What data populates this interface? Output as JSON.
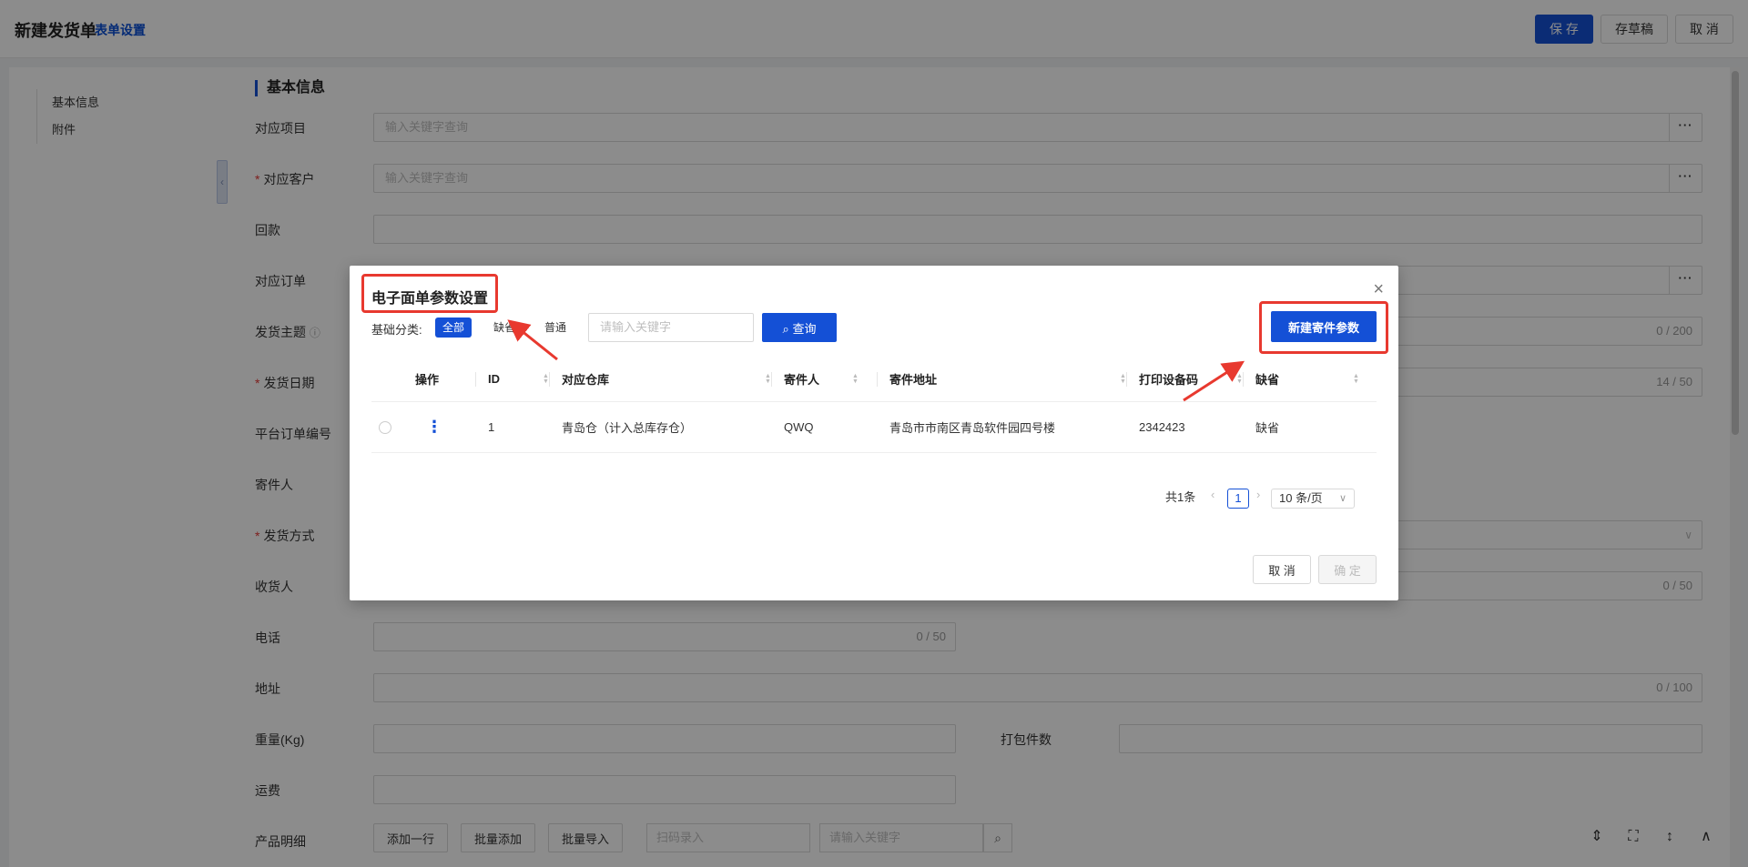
{
  "header": {
    "title": "新建发货单",
    "form_settings": "表单设置",
    "save": "保 存",
    "draft": "存草稿",
    "cancel": "取 消"
  },
  "sidenav": [
    "基本信息",
    "附件"
  ],
  "section_title": "基本信息",
  "fields": {
    "project": {
      "label": "对应项目",
      "placeholder": "输入关键字查询"
    },
    "customer": {
      "label": "对应客户",
      "placeholder": "输入关键字查询"
    },
    "payment": {
      "label": "回款"
    },
    "order": {
      "label": "对应订单"
    },
    "subject": {
      "label": "发货主题",
      "counter": "0 / 200"
    },
    "date": {
      "label": "发货日期",
      "counter": "14 / 50"
    },
    "platform_no": {
      "label": "平台订单编号"
    },
    "sender": {
      "label": "寄件人"
    },
    "method": {
      "label": "发货方式"
    },
    "receiver": {
      "label": "收货人",
      "counter": "0 / 50"
    },
    "phone": {
      "label": "电话",
      "counter": "0 / 50"
    },
    "address": {
      "label": "地址",
      "counter": "0 / 100"
    },
    "weight": {
      "label": "重量(Kg)"
    },
    "packages": {
      "label": "打包件数"
    },
    "freight": {
      "label": "运费"
    },
    "products": {
      "label": "产品明细"
    }
  },
  "product_tools": {
    "add_row": "添加一行",
    "batch_add": "批量添加",
    "batch_import": "批量导入",
    "scan_placeholder": "扫码录入",
    "keyword_placeholder": "请输入关键字"
  },
  "modal": {
    "title": "电子面单参数设置",
    "filter_label": "基础分类:",
    "chips": [
      "全部",
      "缺省",
      "普通"
    ],
    "search_placeholder": "请输入关键字",
    "query": "查询",
    "new_button": "新建寄件参数",
    "columns": [
      "操作",
      "ID",
      "对应仓库",
      "寄件人",
      "寄件地址",
      "打印设备码",
      "缺省"
    ],
    "rows": [
      {
        "id": "1",
        "warehouse": "青岛仓（计入总库存仓）",
        "sender": "QWQ",
        "address": "青岛市市南区青岛软件园四号楼",
        "device": "2342423",
        "default": "缺省"
      }
    ],
    "pager": {
      "total": "共1条",
      "page": "1",
      "size": "10 条/页"
    },
    "cancel": "取 消",
    "ok": "确 定"
  },
  "colors": {
    "primary": "#1450d6",
    "highlight": "#e8392f"
  }
}
